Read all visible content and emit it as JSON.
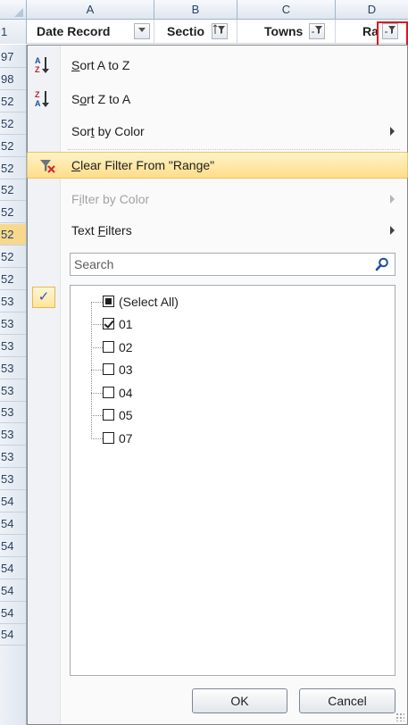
{
  "sheet": {
    "columns": [
      "A",
      "B",
      "C",
      "D"
    ],
    "header_row_num": "1",
    "headers": [
      {
        "label": "Date Record",
        "filter_state": "dropdown"
      },
      {
        "label": "Sectio",
        "filter_state": "filtered-sorted"
      },
      {
        "label": "Towns",
        "filter_state": "filtered"
      },
      {
        "label": "Ra",
        "filter_state": "filtered-active"
      }
    ],
    "row_labels": [
      "97",
      "98",
      "52",
      "52",
      "52",
      "52",
      "52",
      "52",
      "52",
      "52",
      "52",
      "53",
      "53",
      "53",
      "53",
      "53",
      "53",
      "53",
      "53",
      "53",
      "54",
      "54",
      "54",
      "54",
      "54",
      "54",
      "54"
    ],
    "selected_row_index": 8
  },
  "menu": {
    "sort_az": "Sort A to Z",
    "sort_za": "Sort Z to A",
    "sort_by_color": "Sort by Color",
    "clear_filter": "Clear Filter From \"Range\"",
    "filter_by_color": "Filter by Color",
    "text_filters": "Text Filters",
    "search_placeholder": "Search",
    "list": [
      {
        "label": "(Select All)",
        "state": "partial"
      },
      {
        "label": "01",
        "state": "checked"
      },
      {
        "label": "02",
        "state": "unchecked"
      },
      {
        "label": "03",
        "state": "unchecked"
      },
      {
        "label": "04",
        "state": "unchecked"
      },
      {
        "label": "05",
        "state": "unchecked"
      },
      {
        "label": "07",
        "state": "unchecked"
      }
    ],
    "ok_label": "OK",
    "cancel_label": "Cancel"
  },
  "icons": {
    "sort_az": "sort-ascending-icon",
    "sort_za": "sort-descending-icon",
    "clear_filter": "clear-filter-icon",
    "search": "magnifier-icon",
    "submenu": "chevron-right-icon"
  },
  "colors": {
    "highlight": "#ffdd8a",
    "focus_box": "#e0141c",
    "icon_blue": "#1a4fa3"
  }
}
